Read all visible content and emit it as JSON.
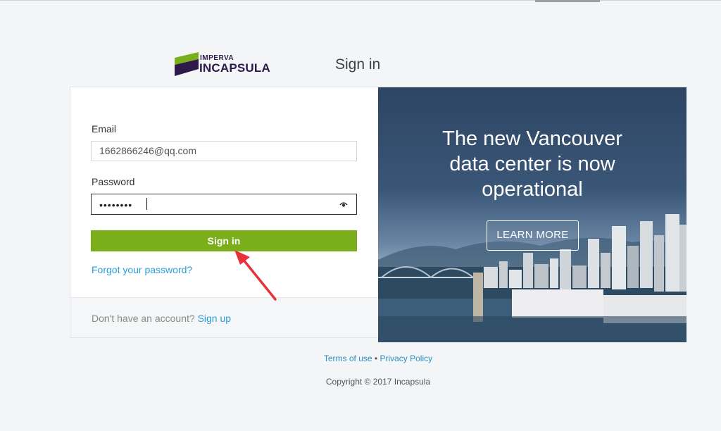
{
  "header": {
    "brand_top": "IMPERVA",
    "brand_main": "INCAPSULA",
    "heading": "Sign in"
  },
  "form": {
    "email_label": "Email",
    "email_value": "1662866246@qq.com",
    "password_label": "Password",
    "password_mask": "••••••••",
    "signin_label": "Sign in",
    "forgot_label": "Forgot your password?",
    "signup_prompt": "Don't have an account?",
    "signup_label": "Sign up"
  },
  "promo": {
    "headline_line1": "The new Vancouver",
    "headline_line2": "data center is now",
    "headline_line3": "operational",
    "button_label": "LEARN MORE"
  },
  "footer": {
    "terms_label": "Terms of use",
    "separator": "•",
    "privacy_label": "Privacy Policy",
    "copyright": "Copyright © 2017 Incapsula"
  },
  "colors": {
    "accent_green": "#7aae1a",
    "link_blue": "#2a9fd6",
    "brand_purple": "#2d1a4a",
    "annotation_red": "#e8323a"
  },
  "icons": [
    "imperva-logo-icon",
    "eye-icon",
    "arrow-annotation-icon"
  ]
}
